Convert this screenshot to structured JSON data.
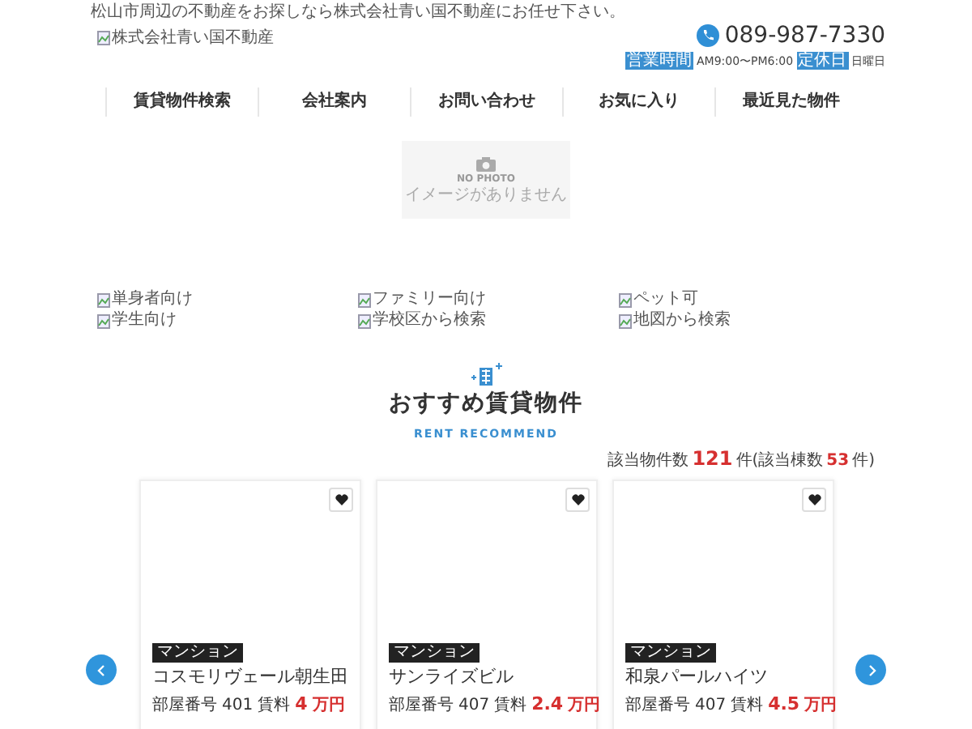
{
  "header": {
    "tagline": "松山市周辺の不動産をお探しなら株式会社青い国不動産にお任せ下さい。",
    "logo_alt": "株式会社青い国不動産",
    "phone": "089-987-7330",
    "hours_label": "営業時間",
    "hours": "AM9:00〜PM6:00",
    "holiday_label": "定休日",
    "holiday": "日曜日"
  },
  "nav": [
    "賃貸物件検索",
    "会社案内",
    "お問い合わせ",
    "お気に入り",
    "最近見た物件"
  ],
  "no_photo": {
    "title": "NO PHOTO",
    "caption": "イメージがありません"
  },
  "quick_links": [
    "単身者向け",
    "ファミリー向け",
    "ペット可",
    "学生向け",
    "学校区から検索",
    "地図から検索"
  ],
  "section": {
    "title": "おすすめ賃貸物件",
    "subtitle": "RENT RECOMMEND"
  },
  "count": {
    "label": "該当物件数",
    "count": "121",
    "unit": "件(該当棟数",
    "buildings": "53",
    "end": "件)"
  },
  "properties": [
    {
      "type": "マンション",
      "name": "コスモリヴェール朝生田",
      "room_label": "部屋番号",
      "room": "401",
      "rent_label": "賃料",
      "rent": "4",
      "rent_unit": "万円"
    },
    {
      "type": "マンション",
      "name": "サンライズビル",
      "room_label": "部屋番号",
      "room": "407",
      "rent_label": "賃料",
      "rent": "2.4",
      "rent_unit": "万円"
    },
    {
      "type": "マンション",
      "name": "和泉パールハイツ",
      "room_label": "部屋番号",
      "room": "407",
      "rent_label": "賃料",
      "rent": "4.5",
      "rent_unit": "万円"
    }
  ]
}
